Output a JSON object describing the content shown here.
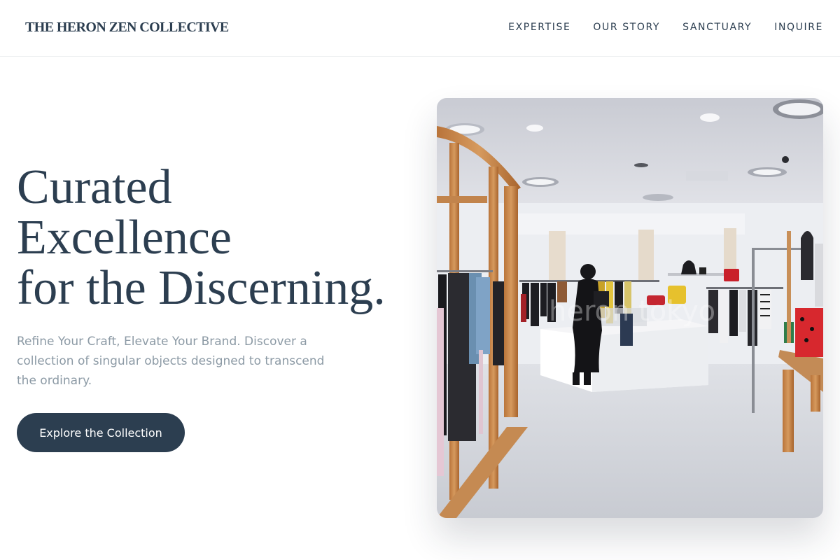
{
  "brand": {
    "name": "THE HERON ZEN COLLECTIVE"
  },
  "nav": {
    "items": [
      {
        "label": "EXPERTISE"
      },
      {
        "label": "OUR STORY"
      },
      {
        "label": "SANCTUARY"
      },
      {
        "label": "INQUIRE"
      }
    ]
  },
  "hero": {
    "title_lines": [
      "Curated",
      "Excellence",
      "for the Discerning."
    ],
    "subtitle": "Refine Your Craft, Elevate Your Brand. Discover a collection of singular objects designed to transcend the ordinary.",
    "cta_label": "Explore the Collection"
  },
  "photo": {
    "watermark": "heron tokyo"
  },
  "colors": {
    "primary": "#2c3e50",
    "muted_text": "#8c9aa5",
    "background": "#ffffff"
  }
}
